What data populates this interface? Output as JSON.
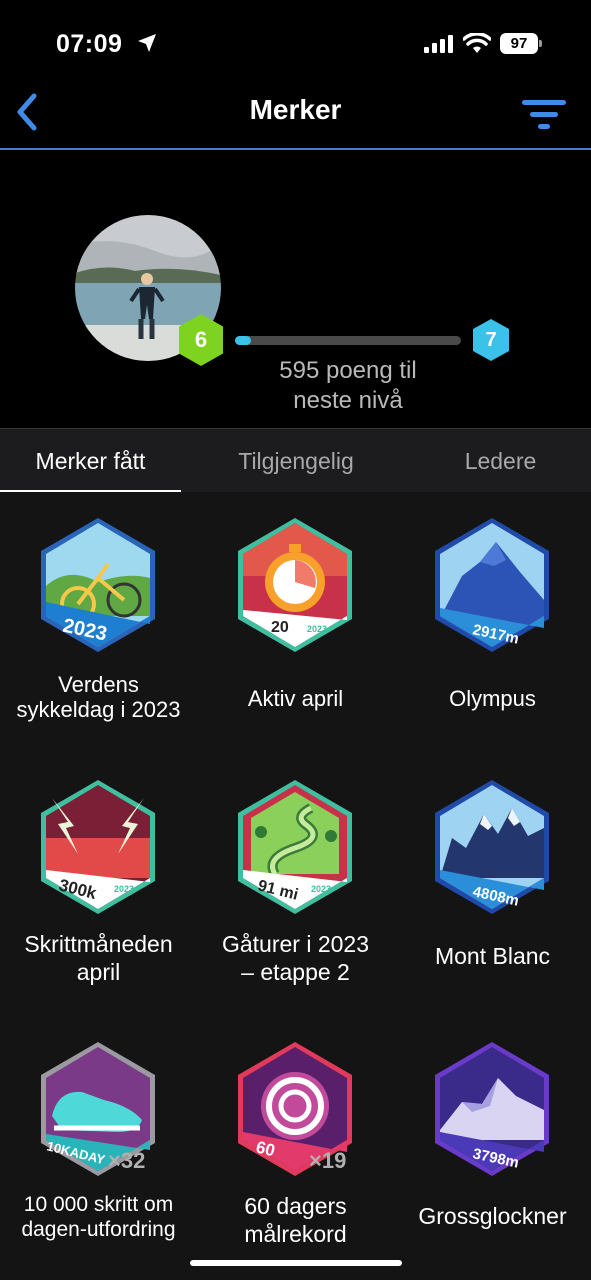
{
  "status_bar": {
    "time": "07:09",
    "battery": "97"
  },
  "nav": {
    "title": "Merker"
  },
  "profile": {
    "current_level": "6",
    "next_level": "7",
    "progress": 0.07,
    "points_line1": "595 poeng til",
    "points_line2": "neste nivå"
  },
  "tabs": [
    "Merker fått",
    "Tilgjengelig",
    "Ledere"
  ],
  "badges": [
    {
      "line1": "Verdens",
      "line2": "sykkeldag i 2023",
      "art": "2023",
      "count": ""
    },
    {
      "line1": "Aktiv april",
      "line2": "",
      "art": "20",
      "art2": "2023",
      "count": ""
    },
    {
      "line1": "Olympus",
      "line2": "",
      "art": "2917m",
      "count": ""
    },
    {
      "line1": "Skrittmåneden",
      "line2": "april",
      "art": "300k",
      "art2": "2023",
      "count": ""
    },
    {
      "line1": "Gåturer i 2023",
      "line2": "– etappe 2",
      "art": "91 mi",
      "art2": "2023",
      "count": ""
    },
    {
      "line1": "Mont Blanc",
      "line2": "",
      "art": "4808m",
      "count": ""
    },
    {
      "line1": "10 000 skritt om",
      "line2": "dagen-utfordring",
      "art": "10KADAY",
      "count": "×32"
    },
    {
      "line1": "60 dagers",
      "line2": "målrekord",
      "art": "60",
      "count": "×19"
    },
    {
      "line1": "Grossglockner",
      "line2": "",
      "art": "3798m",
      "count": ""
    }
  ],
  "colors": {
    "accent": "#3f7fd6",
    "level_current": "#7ed321",
    "level_next": "#3ac2e8"
  }
}
